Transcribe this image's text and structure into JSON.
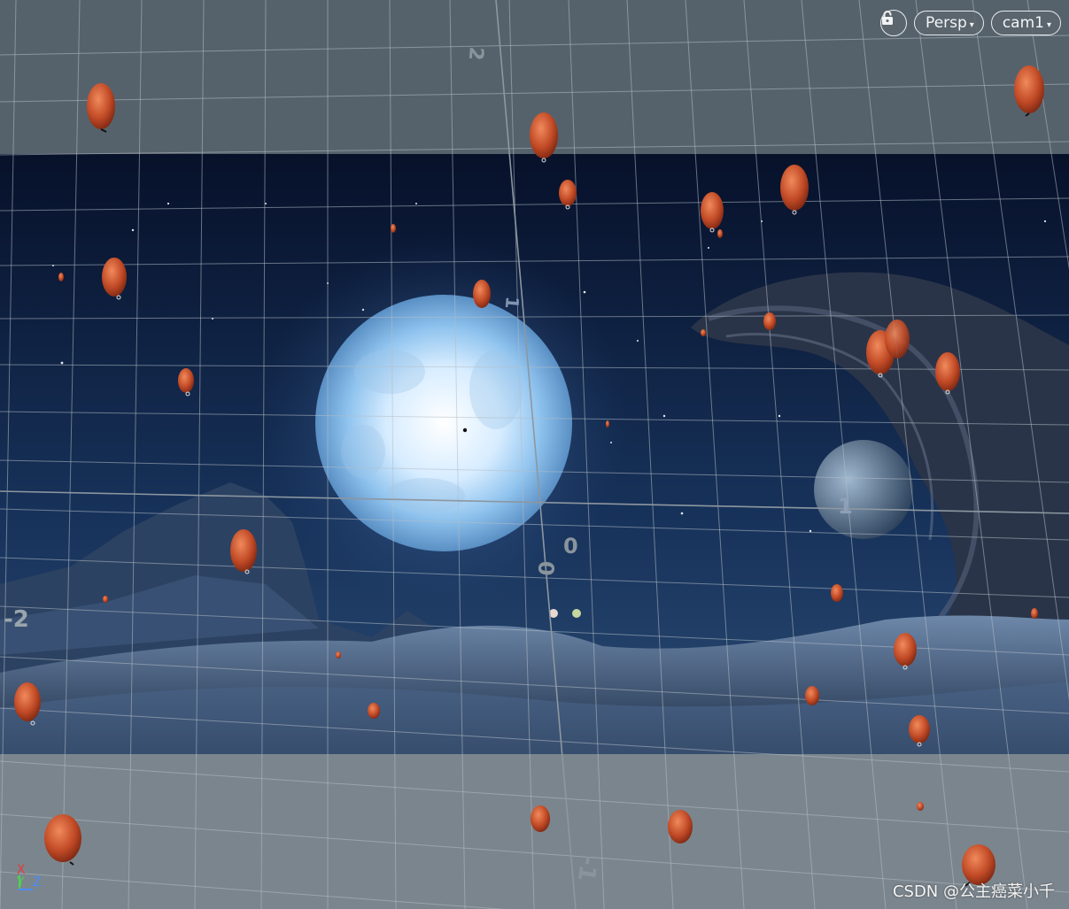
{
  "viewport": {
    "lock_icon": "lock-icon",
    "camera_mode": "Persp",
    "camera_name": "cam1",
    "caret_icon": "caret-down-icon"
  },
  "grid_labels": {
    "top": "2",
    "center_zero_a": "0",
    "center_zero_b": "0",
    "left": "-2",
    "right": "1",
    "moon_label": "1",
    "bottom": "-1"
  },
  "axes": {
    "x": "X",
    "y": "Y",
    "z": "Z"
  },
  "watermark": "CSDN @公主癌菜小千",
  "colors": {
    "background": "#5b6770",
    "sky": "#0b1630",
    "moon": "#dff0ff",
    "lantern": "#c9532e",
    "axis_x": "#e53b3b",
    "axis_y": "#4fd14f",
    "axis_z": "#4a8cff"
  }
}
